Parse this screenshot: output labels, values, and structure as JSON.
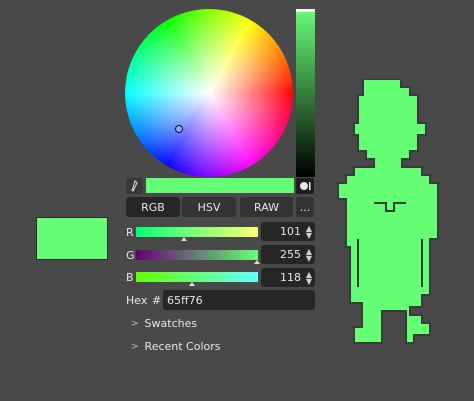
{
  "color": {
    "hex_color": "#65ff76"
  },
  "picker": {
    "eyedropper_icon": "eyedropper-icon",
    "sample_icon": "sample-toggle-icon"
  },
  "modes": {
    "tabs": [
      "RGB",
      "HSV",
      "RAW"
    ],
    "active": "RGB",
    "more_label": "..."
  },
  "sliders": [
    {
      "label": "R",
      "value": "101",
      "fraction": 0.396
    },
    {
      "label": "G",
      "value": "255",
      "fraction": 1.0
    },
    {
      "label": "B",
      "value": "118",
      "fraction": 0.463
    }
  ],
  "hex": {
    "label": "Hex",
    "hash": "#",
    "value": "65ff76"
  },
  "sections": {
    "swatches": "Swatches",
    "recent": "Recent Colors"
  },
  "colors": {
    "sprite_fill": "#65ff76",
    "sprite_outline": "#333333",
    "background": "#494949"
  }
}
